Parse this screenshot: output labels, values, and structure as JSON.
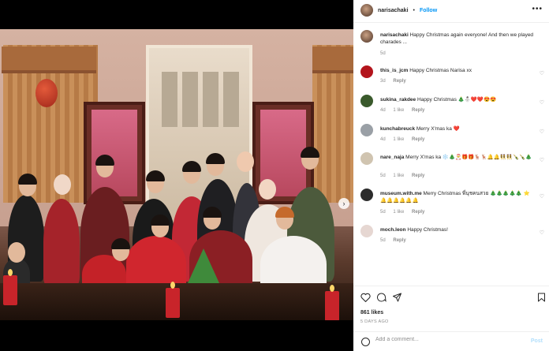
{
  "post": {
    "author": "narisachaki",
    "separator": "•",
    "follow_label": "Follow",
    "more_label": "•••",
    "caption_author": "narisachaki",
    "caption_text": "Happy Christmas again everyone! And then we played charades ...",
    "caption_age": "5d",
    "likes": "861 likes",
    "date": "5 DAYS AGO",
    "add_comment_placeholder": "Add a comment...",
    "post_label": "Post"
  },
  "comments": [
    {
      "user": "this_is_jcm",
      "text": "Happy Christmas Narisa xx",
      "age": "3d",
      "likes": "",
      "reply": "Reply",
      "avatar_color": "#b3141c"
    },
    {
      "user": "sukina_rakdee",
      "text": "Happy Christmas 🎄⛄❤️❤️😍😍",
      "age": "4d",
      "likes": "1 like",
      "reply": "Reply",
      "avatar_color": "#3a5a2c"
    },
    {
      "user": "kunchabreuck",
      "text": "Merry X'mas ka ❤️",
      "age": "4d",
      "likes": "1 like",
      "reply": "Reply",
      "avatar_color": "#9aa0a6"
    },
    {
      "user": "nare_naja",
      "text": "Merry X'mas ka ❄️🎄🎅🎁🎁🦌🦌🔔🔔👯👯🍾🍾🎄",
      "age": "5d",
      "likes": "1 like",
      "reply": "Reply",
      "avatar_color": "#d0c4b0"
    },
    {
      "user": "museum.with.me",
      "text": "Merry Christmas พี่นุชคนสวย 🎄🎄🎄🎄🎄 ⭐🔔🔔🔔🔔🔔🔔",
      "age": "5d",
      "likes": "1 like",
      "reply": "Reply",
      "avatar_color": "#2c2c2c"
    },
    {
      "user": "moch.leon",
      "text": "Happy Christmas!",
      "age": "5d",
      "likes": "",
      "reply": "Reply",
      "avatar_color": "#e6d7d2"
    }
  ],
  "icons": {
    "heart": "heart-icon",
    "comment": "comment-icon",
    "share": "share-icon",
    "bookmark": "bookmark-icon",
    "emoji": "emoji-icon",
    "carousel_next": "chevron-right-icon"
  },
  "colors": {
    "accent": "#0095f6",
    "text": "#262626",
    "muted": "#8e8e8e"
  }
}
